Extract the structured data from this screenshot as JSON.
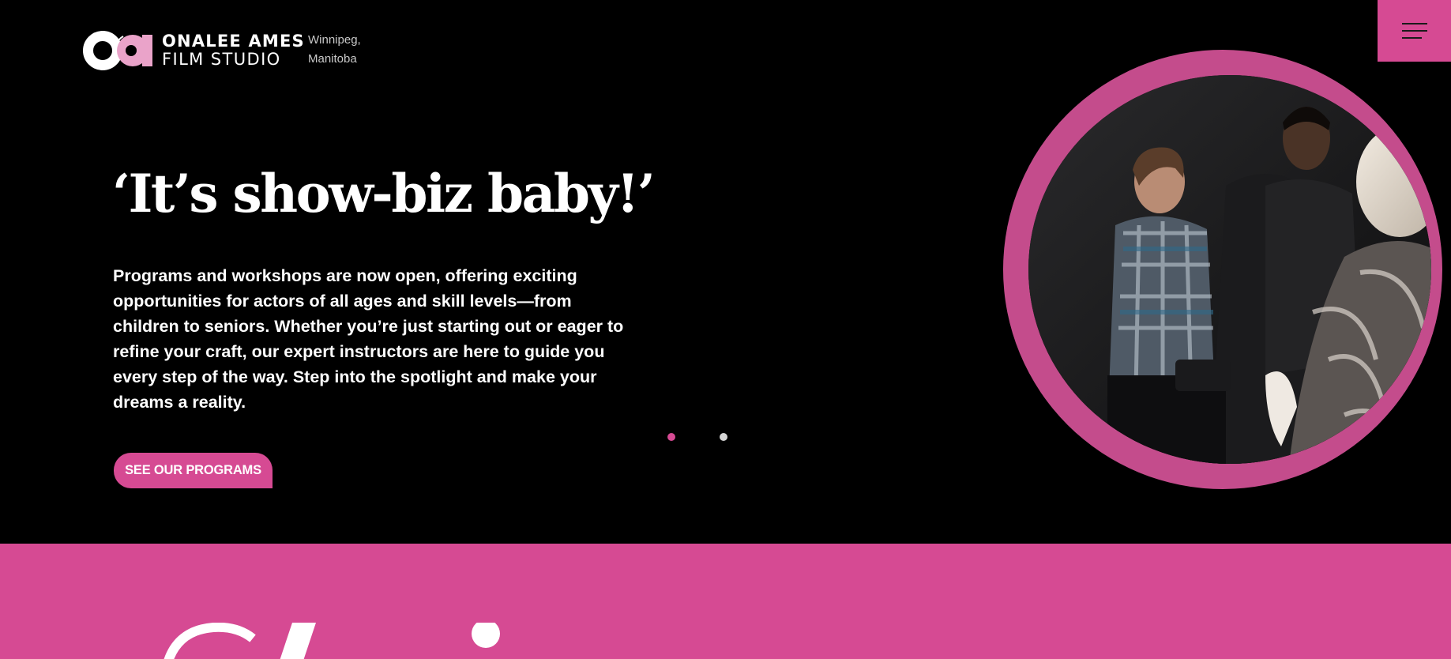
{
  "brand": {
    "name_line1": "ONALEE AMES",
    "name_line2": "FILM STUDIO",
    "location_line1": "Winnipeg,",
    "location_line2": "Manitoba"
  },
  "menu": {
    "icon": "hamburger-menu-icon"
  },
  "hero": {
    "headline": "‘It’s show-biz baby!’",
    "body": "Programs and workshops are now open, offering exciting opportunities for actors of all ages and skill levels—from children to seniors. Whether you’re just starting out or eager to refine your craft, our expert instructors are here to guide you every step of the way. Step into the spotlight and make your dreams a reality.",
    "cta_label": "SEE OUR PROGRAMS",
    "slides": {
      "count": 2,
      "active_index": 0
    }
  },
  "colors": {
    "accent": "#d64a93",
    "ring": "#c44c8c",
    "background": "#000000",
    "text": "#ffffff",
    "muted_text": "#c9c9c9",
    "inactive_dot": "#d6d6d6"
  }
}
